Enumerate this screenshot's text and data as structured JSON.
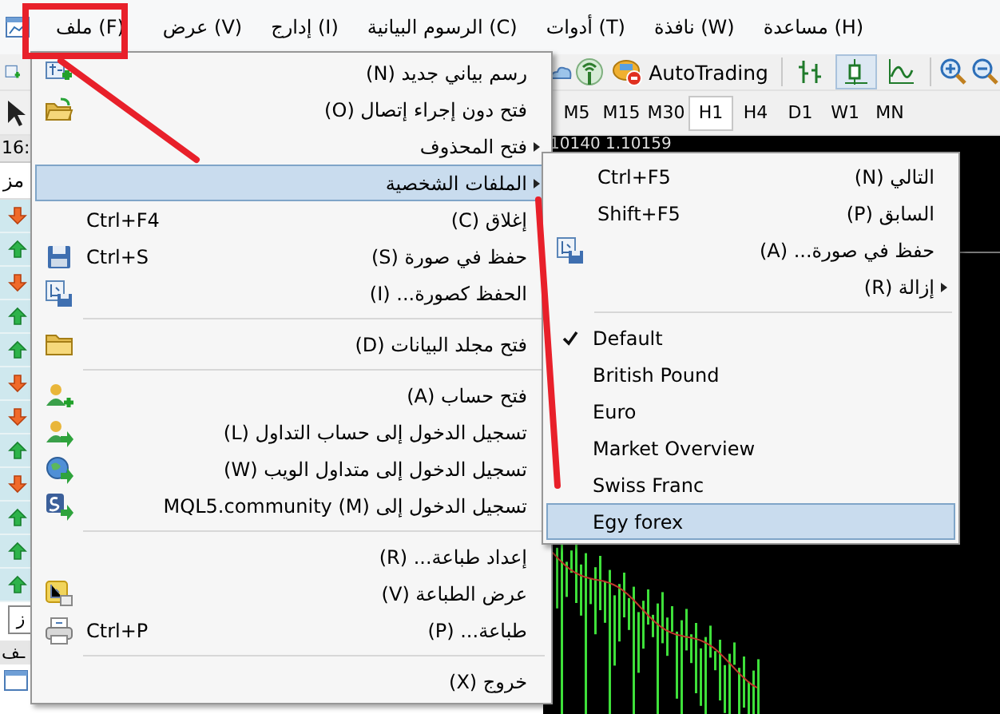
{
  "menu_bar": {
    "items": [
      {
        "label": "مساعدة (H)"
      },
      {
        "label": "نافذة (W)"
      },
      {
        "label": "أدوات (T)"
      },
      {
        "label": "الرسوم البيانية (C)"
      },
      {
        "label": "إدارج (I)"
      },
      {
        "label": "عرض (V)"
      },
      {
        "label": "ملف (F)"
      }
    ]
  },
  "toolbar": {
    "autotrading_label": "AutoTrading",
    "chart_types": [
      {
        "selected": false
      },
      {
        "selected": true
      },
      {
        "selected": false
      }
    ]
  },
  "timeframes": [
    {
      "label": "MN",
      "selected": false
    },
    {
      "label": "W1",
      "selected": false
    },
    {
      "label": "D1",
      "selected": false
    },
    {
      "label": "H4",
      "selected": false
    },
    {
      "label": "H1",
      "selected": true
    },
    {
      "label": "M30",
      "selected": false
    },
    {
      "label": "M15",
      "selected": false
    },
    {
      "label": "M5",
      "selected": false
    }
  ],
  "left_panel": {
    "header": "16:",
    "column_label": "مز",
    "rows": [
      {
        "rising": false
      },
      {
        "rising": true
      },
      {
        "rising": false
      },
      {
        "rising": true
      },
      {
        "rising": true
      },
      {
        "rising": false
      },
      {
        "rising": false
      },
      {
        "rising": true
      },
      {
        "rising": false
      },
      {
        "rising": true
      },
      {
        "rising": true
      },
      {
        "rising": true
      }
    ],
    "tab": "ز",
    "navigator_title": "ـف"
  },
  "chart": {
    "price_header": "10140 1.10159"
  },
  "file_menu": {
    "items": [
      {
        "kind": "item",
        "label": "رسم بياني جديد (N)",
        "submenu": false,
        "selected": false
      },
      {
        "kind": "item",
        "label": "فتح دون إجراء إتصال (O)",
        "submenu": false,
        "selected": false
      },
      {
        "kind": "item",
        "label": "فتح المحذوف",
        "submenu": true,
        "selected": false
      },
      {
        "kind": "item",
        "label": "الملفات الشخصية",
        "submenu": true,
        "selected": true
      },
      {
        "kind": "item",
        "label": "إغلاق (C)",
        "shortcut": "Ctrl+F4",
        "submenu": false,
        "selected": false
      },
      {
        "kind": "item",
        "label": "حفظ في صورة (S)",
        "shortcut": "Ctrl+S",
        "submenu": false,
        "selected": false
      },
      {
        "kind": "item",
        "label": "الحفظ كصورة... (I)",
        "submenu": false,
        "selected": false
      },
      {
        "kind": "separator"
      },
      {
        "kind": "item",
        "label": "فتح مجلد البيانات (D)",
        "submenu": false,
        "selected": false
      },
      {
        "kind": "separator"
      },
      {
        "kind": "item",
        "label": "فتح حساب (A)",
        "submenu": false,
        "selected": false
      },
      {
        "kind": "item",
        "label": "تسجيل الدخول إلى حساب التداول (L)",
        "submenu": false,
        "selected": false
      },
      {
        "kind": "item",
        "label": "تسجيل الدخول إلى متداول الويب (W)",
        "submenu": false,
        "selected": false
      },
      {
        "kind": "item",
        "label": "تسجيل الدخول إلى MQL5.community (M)",
        "submenu": false,
        "selected": false
      },
      {
        "kind": "separator"
      },
      {
        "kind": "item",
        "label": "إعداد طباعة... (R)",
        "submenu": false,
        "selected": false
      },
      {
        "kind": "item",
        "label": "عرض الطباعة (V)",
        "submenu": false,
        "selected": false
      },
      {
        "kind": "item",
        "label": "طباعة... (P)",
        "shortcut": "Ctrl+P",
        "submenu": false,
        "selected": false
      },
      {
        "kind": "separator"
      },
      {
        "kind": "item",
        "label": "خروج (X)",
        "submenu": false,
        "selected": false
      }
    ]
  },
  "profiles_menu": {
    "items": [
      {
        "kind": "item",
        "label": "التالي (N)",
        "shortcut": "Ctrl+F5",
        "submenu": false,
        "checked": false,
        "selected": false
      },
      {
        "kind": "item",
        "label": "السابق (P)",
        "shortcut": "Shift+F5",
        "submenu": false,
        "checked": false,
        "selected": false
      },
      {
        "kind": "item",
        "label": "حفظ في صورة... (A)",
        "submenu": false,
        "checked": false,
        "selected": false
      },
      {
        "kind": "item",
        "label": "إزالة (R)",
        "submenu": true,
        "checked": false,
        "selected": false
      },
      {
        "kind": "separator"
      },
      {
        "kind": "item",
        "label": "Default",
        "submenu": false,
        "checked": true,
        "selected": false
      },
      {
        "kind": "item",
        "label": "British Pound",
        "submenu": false,
        "checked": false,
        "selected": false
      },
      {
        "kind": "item",
        "label": "Euro",
        "submenu": false,
        "checked": false,
        "selected": false
      },
      {
        "kind": "item",
        "label": "Market Overview",
        "submenu": false,
        "checked": false,
        "selected": false
      },
      {
        "kind": "item",
        "label": "Swiss Franc",
        "submenu": false,
        "checked": false,
        "selected": false
      },
      {
        "kind": "item",
        "label": "Egy forex",
        "submenu": false,
        "checked": false,
        "selected": true
      }
    ]
  }
}
